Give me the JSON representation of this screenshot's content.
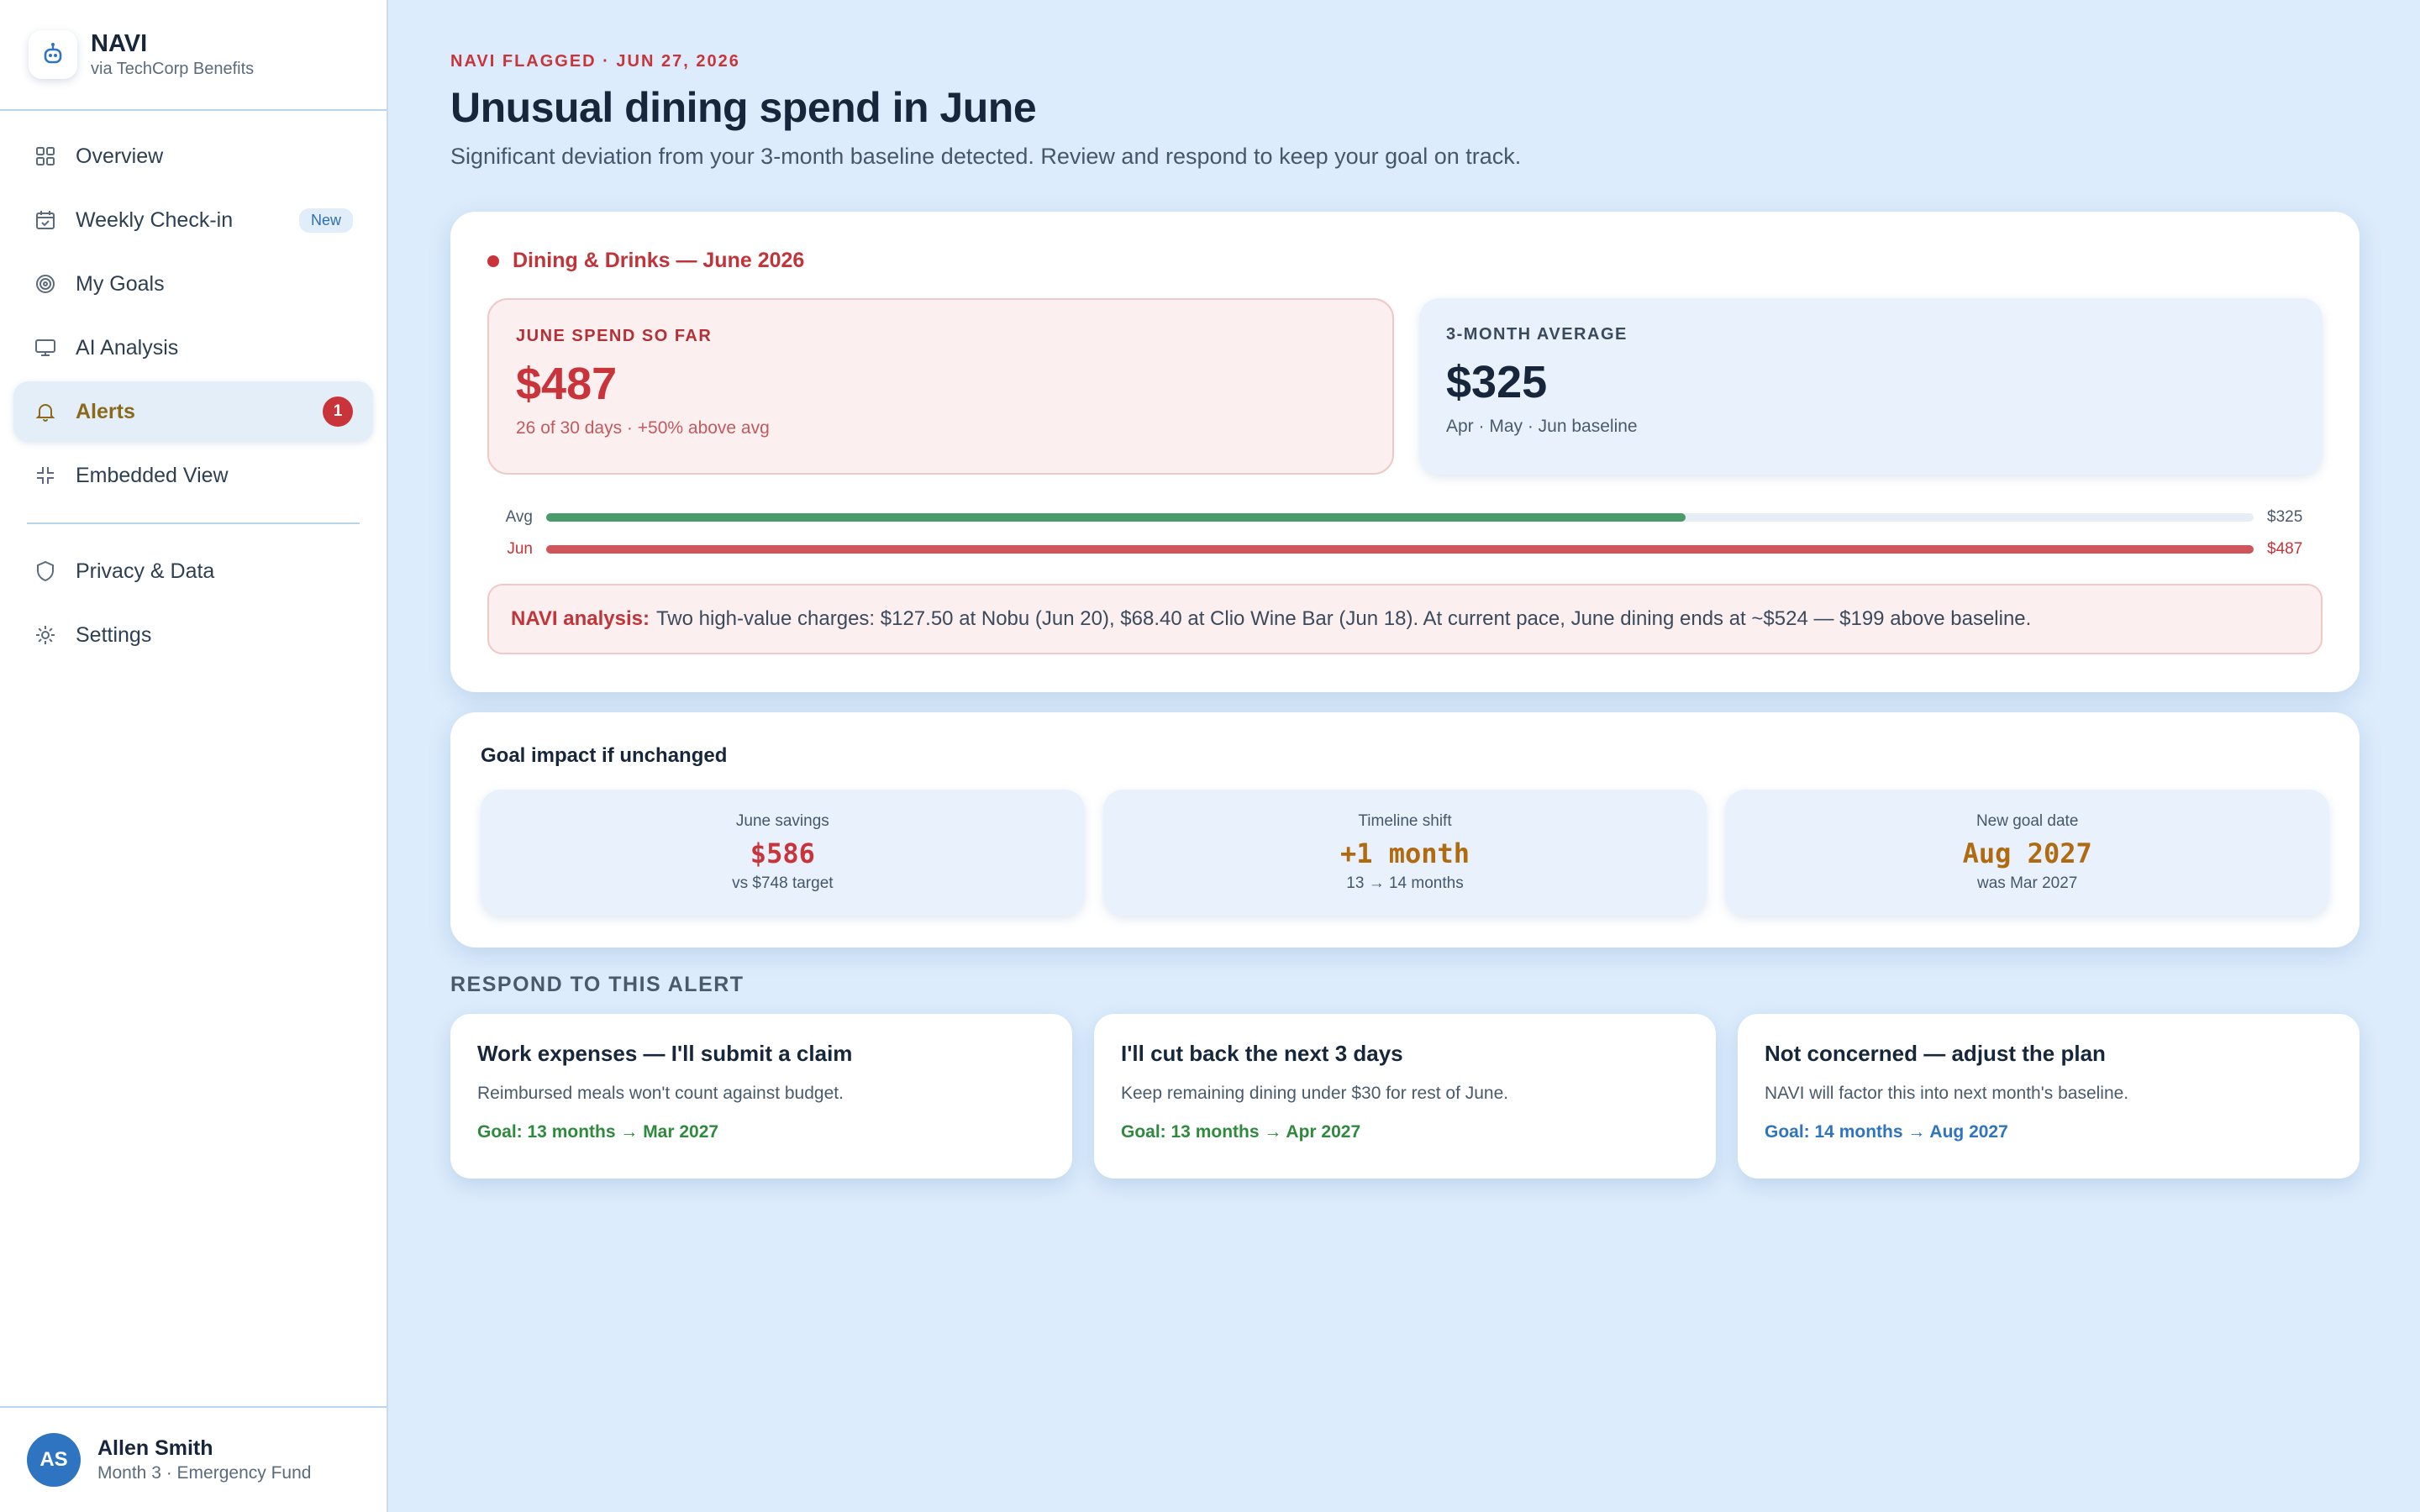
{
  "brand": {
    "name": "NAVI",
    "sub": "via TechCorp Benefits"
  },
  "nav": {
    "items": [
      {
        "label": "Overview",
        "icon": "grid-icon"
      },
      {
        "label": "Weekly Check-in",
        "icon": "calendar-icon",
        "badge": "New"
      },
      {
        "label": "My Goals",
        "icon": "target-icon"
      },
      {
        "label": "AI Analysis",
        "icon": "monitor-icon"
      },
      {
        "label": "Alerts",
        "icon": "bell-icon",
        "count": "1",
        "active": true
      },
      {
        "label": "Embedded View",
        "icon": "embed-icon"
      }
    ],
    "secondary": [
      {
        "label": "Privacy & Data",
        "icon": "shield-icon"
      },
      {
        "label": "Settings",
        "icon": "gear-icon"
      }
    ]
  },
  "user": {
    "initials": "AS",
    "name": "Allen Smith",
    "sub": "Month 3 · Emergency Fund"
  },
  "header": {
    "eyebrow": "NAVI FLAGGED · JUN 27, 2026",
    "title": "Unusual dining spend in June",
    "subtitle": "Significant deviation from your 3-month baseline detected. Review and respond to keep your goal on track."
  },
  "alert": {
    "category": "Dining & Drinks — June 2026",
    "june": {
      "label": "JUNE SPEND SO FAR",
      "value": "$487",
      "note": "26 of 30 days · +50% above avg"
    },
    "average": {
      "label": "3-MONTH AVERAGE",
      "value": "$325",
      "note": "Apr · May · Jun baseline"
    },
    "bars": [
      {
        "label": "Avg",
        "value_text": "$325",
        "value": 325,
        "color": "#4a9a6a",
        "label_color": "#4a5a6c"
      },
      {
        "label": "Jun",
        "value_text": "$487",
        "value": 487,
        "color": "#d0555b",
        "label_color": "#c8343a"
      }
    ],
    "bar_max": 487,
    "analysis_label": "NAVI analysis:",
    "analysis_text": "Two high-value charges: $127.50 at Nobu (Jun 20), $68.40 at Clio Wine Bar (Jun 18). At current pace, June dining ends at ~$524 — $199 above baseline."
  },
  "impact": {
    "title": "Goal impact if unchanged",
    "items": [
      {
        "label": "June savings",
        "value": "$586",
        "sub": "vs $748 target",
        "color": "#c8343a"
      },
      {
        "label": "Timeline shift",
        "value": "+1 month",
        "sub": "13 → 14 months",
        "color": "#b06a10"
      },
      {
        "label": "New goal date",
        "value": "Aug 2027",
        "sub": "was Mar 2027",
        "color": "#b06a10"
      }
    ]
  },
  "respond": {
    "heading": "RESPOND TO THIS ALERT",
    "options": [
      {
        "title": "Work expenses — I'll submit a claim",
        "desc": "Reimbursed meals won't count against budget.",
        "goal": "Goal: 13 months → Mar 2027",
        "color": "#2f8a3e"
      },
      {
        "title": "I'll cut back the next 3 days",
        "desc": "Keep remaining dining under $30 for rest of June.",
        "goal": "Goal: 13 months → Apr 2027",
        "color": "#2f8a3e"
      },
      {
        "title": "Not concerned — adjust the plan",
        "desc": "NAVI will factor this into next month's baseline.",
        "goal": "Goal: 14 months → Aug 2027",
        "color": "#2f74c0"
      }
    ]
  }
}
